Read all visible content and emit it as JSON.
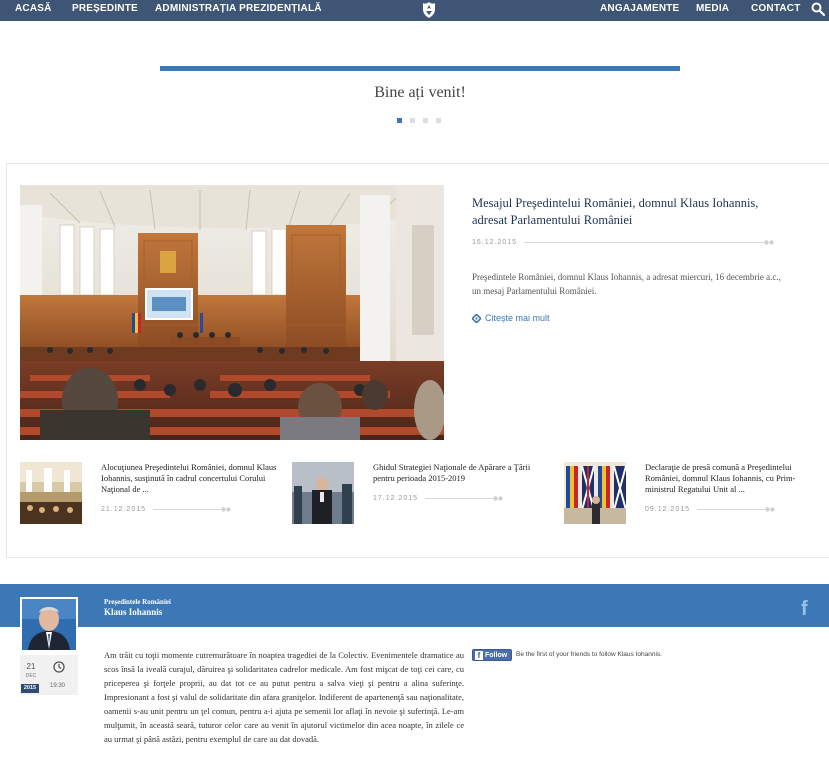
{
  "nav": {
    "left": [
      "ACASĂ",
      "PREȘEDINTE",
      "ADMINISTRAȚIA PREZIDENȚIALĂ"
    ],
    "right": [
      "ANGAJAMENTE",
      "MEDIA",
      "CONTACT"
    ],
    "crest_icon": "romanian-coat-of-arms-icon",
    "search_icon": "search-icon"
  },
  "welcome": {
    "text": "Bine ați venit!",
    "dots_total": 4,
    "dots_active": 1
  },
  "featured": {
    "title": "Mesajul Preşedintelui României, domnul Klaus Iohannis, adresat Parlamentului României",
    "date": "16.12.2015",
    "description": "Preşedintele României, domnul Klaus Iohannis, a adresat miercuri, 16 decembrie a.c., un mesaj Parlamentului României.",
    "read_more": "Citește mai mult"
  },
  "news": [
    {
      "title": "Alocuţiunea Preşedintelui României, domnul Klaus Iohannis, susţinută în cadrul concertului Corului Naţional de ...",
      "date": "21.12.2015"
    },
    {
      "title": "Ghidul Strategiei Naţionale de Apărare a Ţării pentru perioada 2015-2019",
      "date": "17.12.2015"
    },
    {
      "title": "Declaraţie de presă comună a Preşedintelui României, domnul Klaus Iohannis, cu Prim-ministrul Regatului Unit al ...",
      "date": "09.12.2015"
    }
  ],
  "social": {
    "role": "Președintele României",
    "name": "Klaus Iohannis",
    "day": "21",
    "month": "DEC",
    "year": "2015",
    "time": "19:30",
    "post": "Am trăit cu toţii momente cutremurătoare în noaptea tragediei de la Colectiv. Evenimentele dramatice au scos însă la iveală curajul, dăruirea şi solidaritatea cadrelor medicale. Am fost mişcat de toţi cei care, cu priceperea şi forţele proprii, au dat tot ce au putut pentru a salva vieţi şi pentru a alina suferinţe. Impresionant a fost şi valul de solidaritate din afara graniţelor. Indiferent de apartenenţă sau naţionalitate, oamenii s-au unit pentru un ţel comun, pentru a-i ajuta pe semenii lor aflaţi în nevoie şi suferinţă. Le-am mulţumit, în această seară, tuturor celor care au venit în ajutorul victimelor din acea noapte, în zilele ce au urmat şi până astăzi, pentru exemplul de care au dat dovadă.",
    "follow_label": "Follow",
    "follow_text": "Be the first of your friends to follow Klaus Iohannis.",
    "fb_icon": "facebook-icon"
  },
  "colors": {
    "nav_bg": "#3e5575",
    "accent": "#3c78b5",
    "title_dark": "#1d3553",
    "footer_dark": "#2d4d77"
  }
}
